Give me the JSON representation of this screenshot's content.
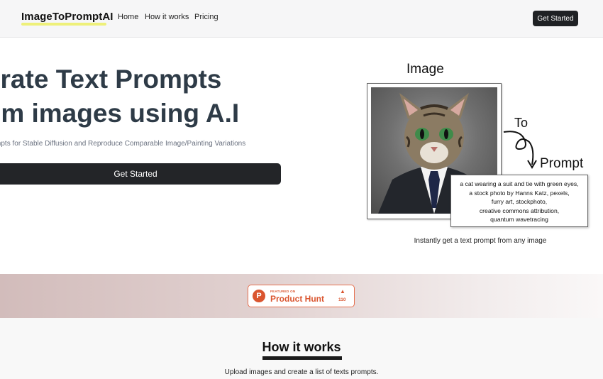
{
  "header": {
    "logo": "ImageToPromptAI",
    "nav": {
      "home": "Home",
      "how": "How it works",
      "pricing": "Pricing"
    },
    "cta": "Get Started"
  },
  "hero": {
    "title_line1": "Generate Text Prompts",
    "title_line2": "from images using A.I",
    "subtitle": "Generate Prompts for Stable Diffusion and Reproduce Comparable Image/Painting Variations",
    "cta": "Get Started"
  },
  "illustration": {
    "image_label": "Image",
    "to_label": "To",
    "prompt_label": "Prompt",
    "prompt_lines": [
      "a cat wearing a suit and tie with green eyes,",
      "a stock photo by Hanns Katz, pexels,",
      "furry art, stockphoto,",
      "creative commons attribution,",
      "quantum wavetracing"
    ],
    "caption": "Instantly get a text prompt from any image"
  },
  "product_hunt": {
    "featured": "FEATURED ON",
    "name": "Product Hunt",
    "count": "110",
    "logo_letter": "P"
  },
  "how_it_works": {
    "title": "How it works",
    "subtitle": "Upload images and create a list of texts prompts."
  },
  "colors": {
    "header_bg": "#f6f6f7",
    "button_dark": "#232528",
    "hero_text": "#2e3b47",
    "logo_highlight": "#eef07a",
    "product_hunt": "#da552f"
  }
}
